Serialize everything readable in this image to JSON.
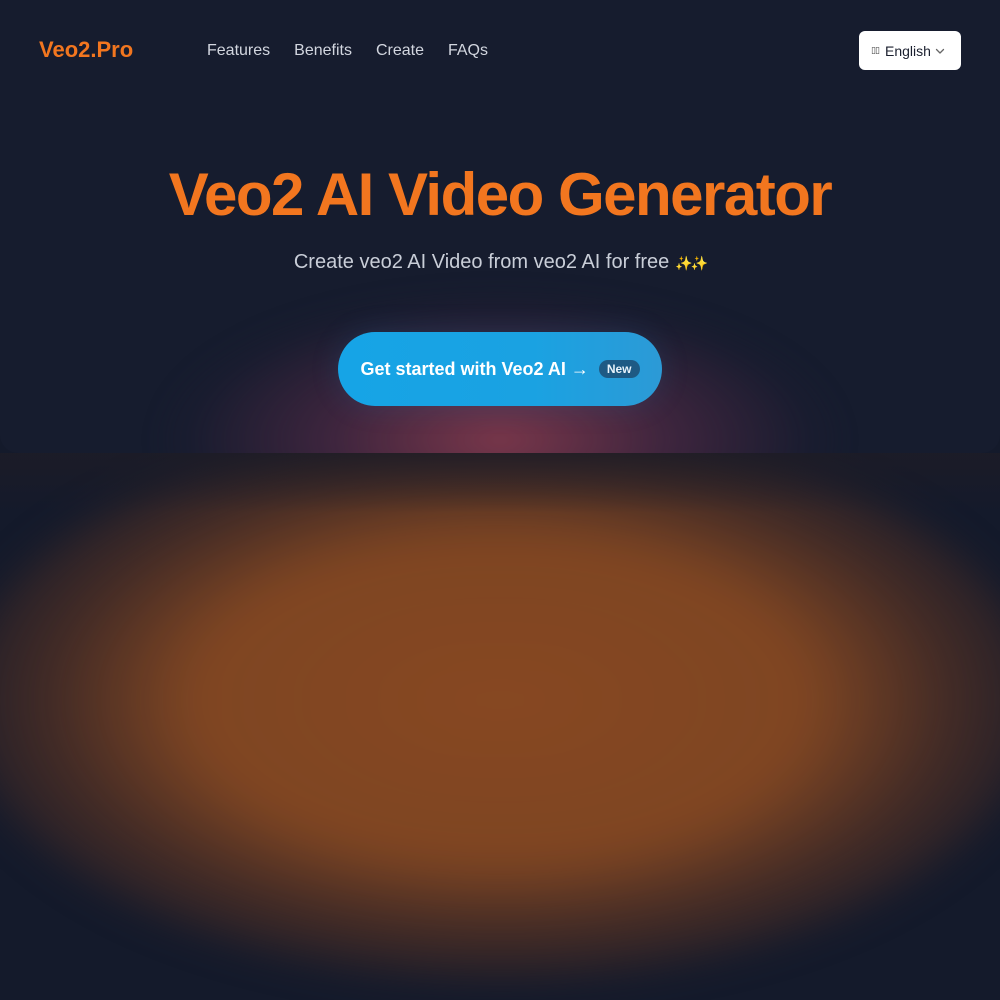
{
  "nav": {
    "logo": "Veo2.Pro",
    "links": [
      "Features",
      "Benefits",
      "Create",
      "FAQs"
    ],
    "language": {
      "selected": "English",
      "icon": "flag-icon"
    }
  },
  "hero": {
    "title": "Veo2 AI Video Generator",
    "subtitle": "Create veo2 AI Video from veo2 AI for free",
    "subtitle_decoration": "✨✨",
    "cta_label": "Get started with Veo2 AI →",
    "cta_badge": "New"
  },
  "colors": {
    "brand_orange": "#f2761f",
    "cta_blue": "#16a4e6",
    "background": "#141a2b",
    "glow_orange": "#874822"
  }
}
